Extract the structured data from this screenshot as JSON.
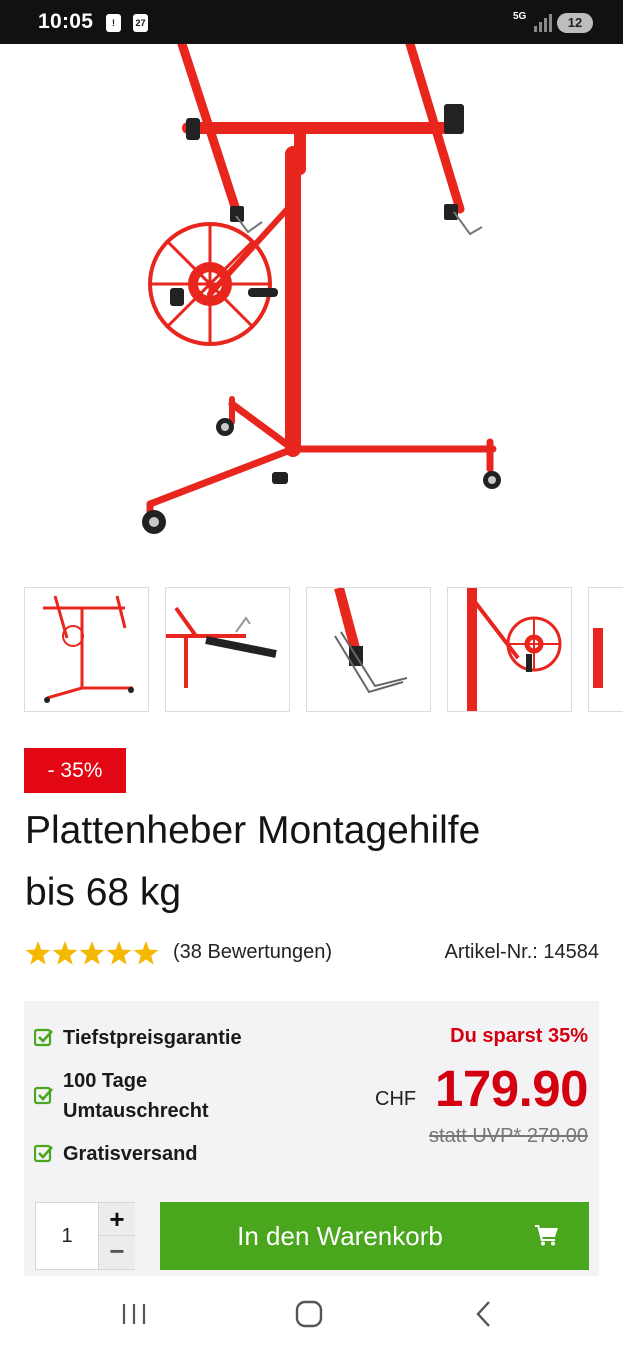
{
  "status_bar": {
    "time": "10:05",
    "notif_alert": "!",
    "notif_calendar": "27",
    "network": "5G",
    "battery": "12"
  },
  "icons": {
    "star_color": "#f5b800",
    "check_color": "#4aa61c"
  },
  "colors": {
    "accent_red": "#e30613",
    "price_red": "#d4000f",
    "cart_green": "#4aa61c",
    "product_red": "#e8261d"
  },
  "product": {
    "discount_badge": "- 35%",
    "title_line1": "Plattenheber Montagehilfe",
    "title_line2": "bis 68 kg",
    "rating": 5,
    "reviews": "(38 Bewertungen)",
    "article_number": "Artikel-Nr.: 14584"
  },
  "features": [
    "Tiefstpreisgarantie",
    "100 Tage Umtauschrecht",
    "Gratisversand"
  ],
  "pricing": {
    "savings": "Du sparst 35%",
    "currency": "CHF",
    "price": "179.90",
    "uvp": "statt UVP* 279.00"
  },
  "cart": {
    "quantity": "1",
    "plus": "+",
    "minus": "−",
    "button_label": "In den Warenkorb"
  },
  "nav": [
    "recent-apps",
    "home",
    "back"
  ]
}
